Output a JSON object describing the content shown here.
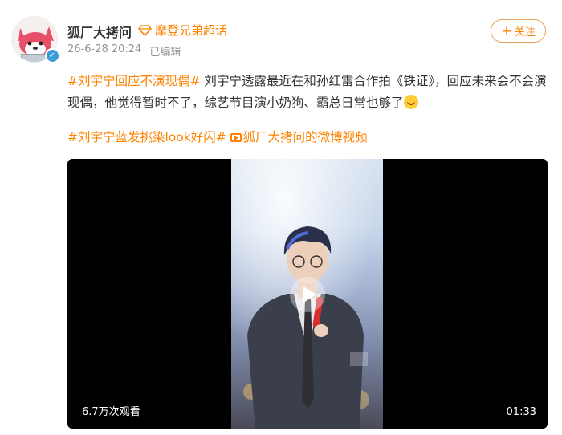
{
  "user": {
    "name": "狐厂大拷问",
    "supertopic": "摩登兄弟超话",
    "timestamp": "26-6-28 20:24",
    "edited_label": "已编辑",
    "verified": true
  },
  "follow_button": {
    "label": "关注",
    "icon": "plus-icon"
  },
  "content": {
    "hashtag_1": "#刘宇宁回应不演现偶#",
    "text_1": " 刘宇宁透露最近在和孙红雷合作拍《铁证》，回应未来会不会演现偶，他觉得暂时不了，综艺节目演小奶狗、霸总日常也够了",
    "emoji": "laugh-emoji",
    "hashtag_2": "#刘宇宁蓝发挑染look好闪#",
    "video_link": "狐厂大拷问的微博视频"
  },
  "video": {
    "view_count": "6.7万次观看",
    "duration": "01:33",
    "play_icon": "play-icon"
  },
  "colors": {
    "accent": "#ff8200",
    "verify": "#3d9bd6",
    "meta_text": "#939393"
  }
}
